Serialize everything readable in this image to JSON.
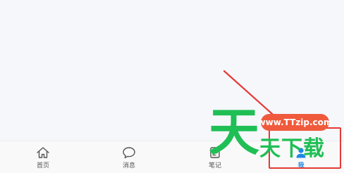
{
  "tabs": [
    {
      "label": "首页",
      "icon": "home-icon"
    },
    {
      "label": "消息",
      "icon": "chat-bubble-icon"
    },
    {
      "label": "笔记",
      "icon": "note-icon"
    },
    {
      "label": "我",
      "icon": "profile-icon",
      "active": true
    }
  ],
  "watermark": {
    "logo_char": "天",
    "site_text": "www.TTzip.com",
    "chars": "天下载"
  },
  "colors": {
    "background": "#f5f7fb",
    "tab_bar": "#f9f9f9",
    "highlight": "#e53935",
    "active_tab": "#1e88e5",
    "watermark_green": "#1fbf55",
    "watermark_pill": "#f05a3c"
  }
}
